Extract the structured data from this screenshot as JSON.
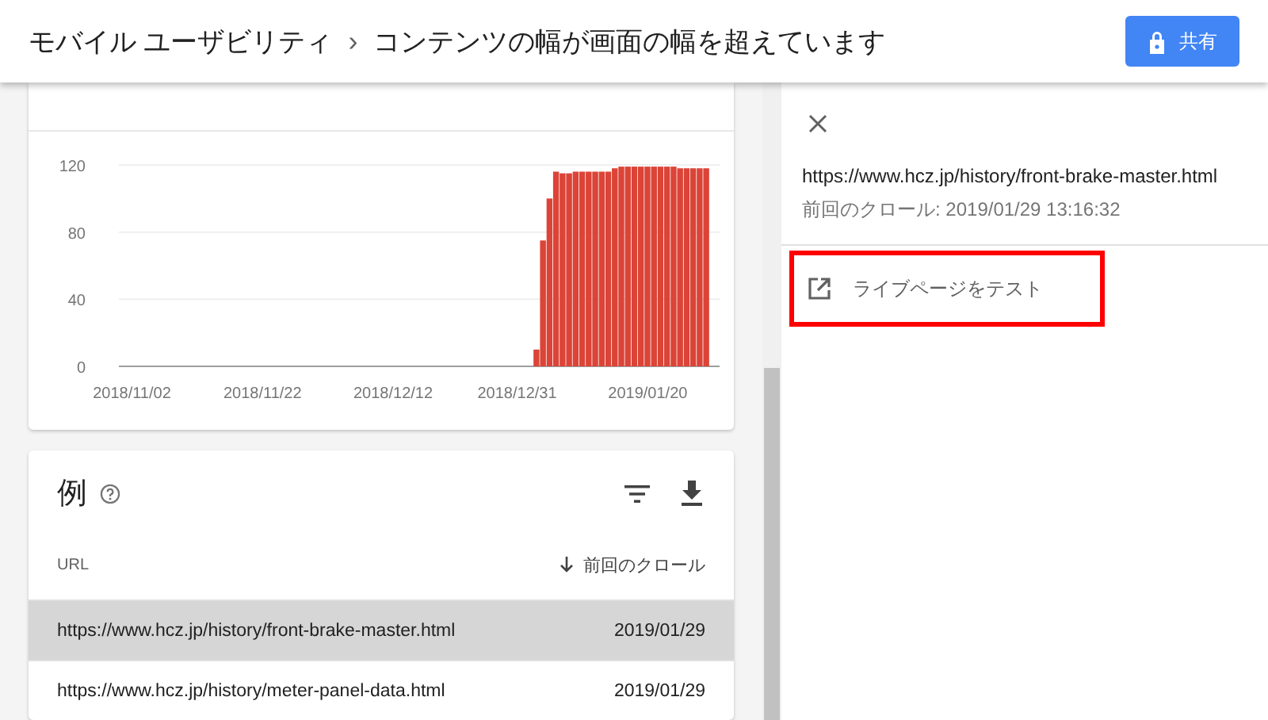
{
  "header": {
    "breadcrumb": [
      "モバイル ユーザビリティ",
      "コンテンツの幅が画面の幅を超えています"
    ],
    "separator": "›",
    "share_button": "共有"
  },
  "chart_card": {
    "chart_data": {
      "type": "bar",
      "categories": [
        "2018/11/02",
        null,
        null,
        null,
        null,
        null,
        null,
        null,
        null,
        null,
        null,
        null,
        null,
        null,
        null,
        null,
        null,
        null,
        null,
        null,
        "2018/11/22",
        null,
        null,
        null,
        null,
        null,
        null,
        null,
        null,
        null,
        null,
        null,
        null,
        null,
        null,
        null,
        null,
        null,
        null,
        null,
        "2018/12/12",
        null,
        null,
        null,
        null,
        null,
        null,
        null,
        null,
        null,
        null,
        null,
        null,
        null,
        null,
        null,
        null,
        null,
        null,
        "2018/12/31",
        null,
        null,
        null,
        null,
        null,
        null,
        null,
        null,
        null,
        null,
        null,
        null,
        null,
        null,
        null,
        null,
        null,
        null,
        null,
        "2019/01/20",
        null,
        null,
        null,
        null,
        null,
        null,
        null,
        null,
        null
      ],
      "series": [
        {
          "color": "#db4437",
          "values": [
            0,
            0,
            0,
            0,
            0,
            0,
            0,
            0,
            0,
            0,
            0,
            0,
            0,
            0,
            0,
            0,
            0,
            0,
            0,
            0,
            0,
            0,
            0,
            0,
            0,
            0,
            0,
            0,
            0,
            0,
            0,
            0,
            0,
            0,
            0,
            0,
            0,
            0,
            0,
            0,
            0,
            0,
            0,
            0,
            0,
            0,
            0,
            0,
            0,
            0,
            0,
            0,
            0,
            0,
            0,
            0,
            0,
            0,
            0,
            0,
            0,
            0,
            10,
            75,
            100,
            116,
            115,
            115,
            116,
            116,
            116,
            116,
            116,
            116,
            118,
            119,
            119,
            119,
            119,
            119,
            119,
            119,
            119,
            119,
            118,
            118,
            118,
            118,
            118
          ]
        }
      ],
      "ylim": [
        0,
        120
      ],
      "yticks": [
        0,
        40,
        80,
        120
      ]
    }
  },
  "examples": {
    "title": "例",
    "columns": [
      {
        "label": "URL",
        "sorted": false
      },
      {
        "label": "前回のクロール",
        "sorted": true
      }
    ],
    "rows": [
      {
        "url": "https://www.hcz.jp/history/front-brake-master.html",
        "date": "2019/01/29",
        "selected": true
      },
      {
        "url": "https://www.hcz.jp/history/meter-panel-data.html",
        "date": "2019/01/29",
        "selected": false
      }
    ]
  },
  "detail_panel": {
    "url": "https://www.hcz.jp/history/front-brake-master.html",
    "last_crawl": "前回のクロール: 2019/01/29 13:16:32",
    "action": "ライブページをテスト",
    "action_highlighted": true
  }
}
